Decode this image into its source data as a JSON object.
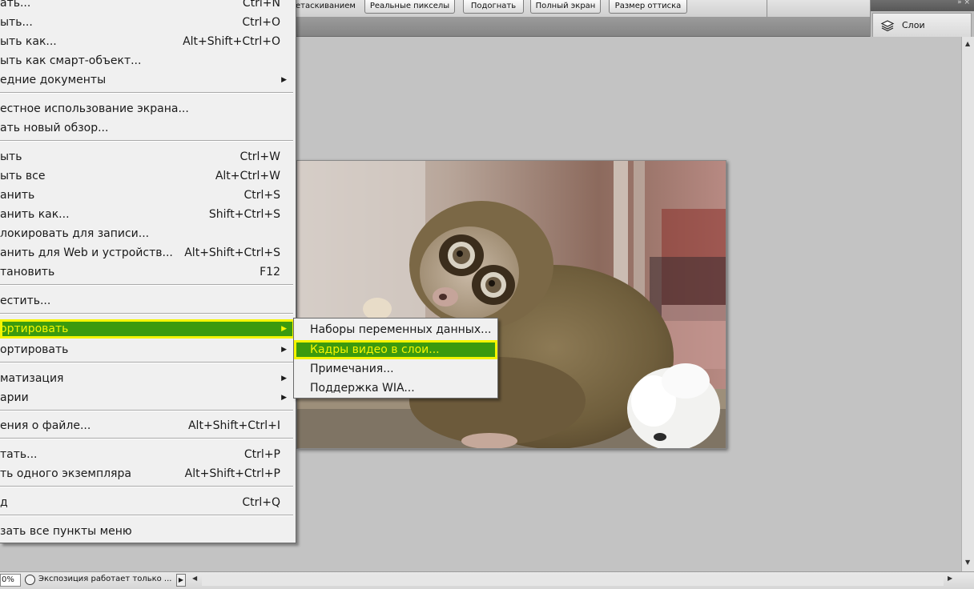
{
  "options_bar": {
    "partial_label": "етаскиванием",
    "buttons": [
      "Реальные пикселы",
      "Подогнать",
      "Полный экран",
      "Размер оттиска"
    ]
  },
  "panel_dock": {
    "arrows": "» ×",
    "layers_label": "Слои"
  },
  "file_menu": {
    "items": [
      {
        "label": "ать...",
        "shortcut": "Ctrl+N"
      },
      {
        "label": "ыть...",
        "shortcut": "Ctrl+O"
      },
      {
        "label": "ыть как...",
        "shortcut": "Alt+Shift+Ctrl+O"
      },
      {
        "label": "ыть как смарт-объект...",
        "shortcut": ""
      },
      {
        "label": "едние документы",
        "shortcut": "",
        "submenu": true
      },
      {
        "label": "естное использование экрана...",
        "shortcut": ""
      },
      {
        "label": "ать новый обзор...",
        "shortcut": ""
      },
      {
        "label": "ыть",
        "shortcut": "Ctrl+W"
      },
      {
        "label": "ыть все",
        "shortcut": "Alt+Ctrl+W"
      },
      {
        "label": "анить",
        "shortcut": "Ctrl+S"
      },
      {
        "label": "анить как...",
        "shortcut": "Shift+Ctrl+S"
      },
      {
        "label": "локировать для записи...",
        "shortcut": ""
      },
      {
        "label": "анить для Web и устройств...",
        "shortcut": "Alt+Shift+Ctrl+S"
      },
      {
        "label": "тановить",
        "shortcut": "F12"
      },
      {
        "label": "естить...",
        "shortcut": ""
      },
      {
        "label": "ортировать",
        "shortcut": "",
        "submenu": true,
        "highlighted": true
      },
      {
        "label": "ортировать",
        "shortcut": "",
        "submenu": true
      },
      {
        "label": "матизация",
        "shortcut": "",
        "submenu": true
      },
      {
        "label": "арии",
        "shortcut": "",
        "submenu": true
      },
      {
        "label": "ения о файле...",
        "shortcut": "Alt+Shift+Ctrl+I"
      },
      {
        "label": "тать...",
        "shortcut": "Ctrl+P"
      },
      {
        "label": "ть одного экземпляра",
        "shortcut": "Alt+Shift+Ctrl+P"
      },
      {
        "label": "д",
        "shortcut": "Ctrl+Q"
      },
      {
        "label": "зать все пункты меню",
        "shortcut": ""
      }
    ]
  },
  "import_submenu": {
    "items": [
      {
        "label": "Наборы переменных данных..."
      },
      {
        "label": "Кадры видео в слои...",
        "highlighted": true
      },
      {
        "label": "Примечания..."
      },
      {
        "label": "Поддержка WIA..."
      }
    ]
  },
  "status_bar": {
    "zoom": "0%",
    "info_text": "Экспозиция работает только ...",
    "menu_arrow": "▶",
    "scroll_left": "◀",
    "scroll_right": "▶"
  },
  "scrollbar": {
    "up": "▲",
    "down": "▼"
  },
  "colors": {
    "highlight_bg": "#3b9a0e",
    "highlight_text": "#f6f600",
    "highlight_border": "#f4f400",
    "menu_bg": "#f0f0f0",
    "workspace_bg": "#c3c3c3"
  }
}
